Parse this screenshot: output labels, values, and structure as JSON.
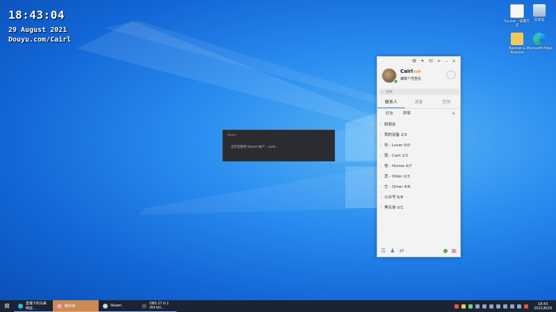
{
  "overlay": {
    "clock": "18:43:04",
    "date": "29 August 2021",
    "site": "Douyu.com/Cairl"
  },
  "desktop_icons": [
    {
      "label": "Go.bat - 快捷方式",
      "icon": "shortcut-icon"
    },
    {
      "label": "回收站",
      "icon": "recycle-bin-icon"
    },
    {
      "label": "Backup & Restore",
      "icon": "folder-icon"
    },
    {
      "label": "Microsoft Edge",
      "icon": "edge-icon"
    }
  ],
  "steam_dialog": {
    "title": "Steam",
    "message": "正在连接到 Steam 帐户：carls..."
  },
  "qq": {
    "nickname": "Cairl",
    "vip_badge": "SVIP",
    "signature": "编辑个性签名",
    "search_placeholder": "搜索",
    "tabs": [
      "联系人",
      "消息",
      "空间"
    ],
    "subtabs": [
      "好友",
      "群聊"
    ],
    "groups": [
      {
        "label": "新朋友"
      },
      {
        "label": "我的设备 2/3"
      },
      {
        "label": "你 - Lover 0/0"
      },
      {
        "label": "我 - Cairl 1/1"
      },
      {
        "label": "他 - Homie 4/7"
      },
      {
        "label": "其 - Older 2/3"
      },
      {
        "label": "它 - Other 4/8"
      },
      {
        "label": "公众号 6/6"
      },
      {
        "label": "黑名单 0/1"
      }
    ],
    "accent": "#2d8cf0"
  },
  "taskbar": {
    "tasks": [
      {
        "label": "直播下的马来西亚...",
        "icon": "edge-icon",
        "active": false
      },
      {
        "label": "腾讯课",
        "icon": "app-icon",
        "active": true
      },
      {
        "label": "Steam",
        "icon": "steam-icon",
        "active": false
      },
      {
        "label": "OBS 27.0.1 (64 bit...",
        "icon": "obs-icon",
        "active": false
      }
    ],
    "time": "18:43",
    "date": "2021/8/29"
  }
}
